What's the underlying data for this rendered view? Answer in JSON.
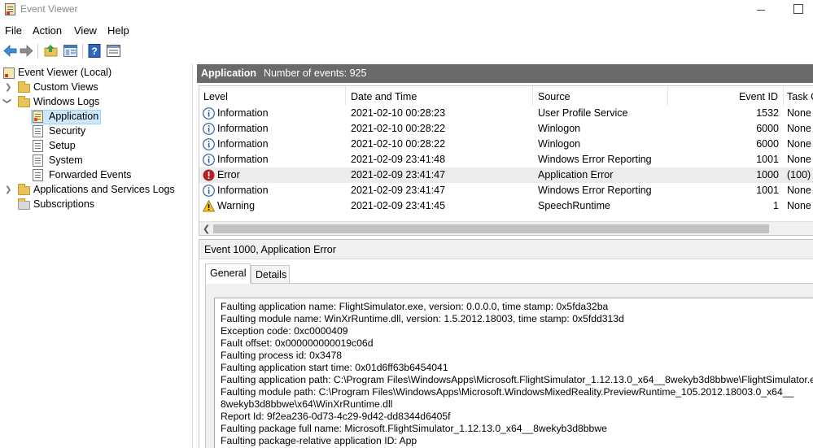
{
  "window": {
    "title": "Event Viewer"
  },
  "menu": [
    "File",
    "Action",
    "View",
    "Help"
  ],
  "toolbar": {
    "icons": [
      "back-arrow-icon",
      "forward-arrow-icon",
      "up-folder-icon",
      "show-hide-tree-icon",
      "help-icon",
      "properties-icon"
    ]
  },
  "tree": {
    "root": "Event Viewer (Local)",
    "custom_views": "Custom Views",
    "windows_logs": "Windows Logs",
    "logs": [
      "Application",
      "Security",
      "Setup",
      "System",
      "Forwarded Events"
    ],
    "apps_services": "Applications and Services Logs",
    "subscriptions": "Subscriptions"
  },
  "header": {
    "name": "Application",
    "count": "Number of events: 925"
  },
  "grid": {
    "columns": [
      "Level",
      "Date and Time",
      "Source",
      "Event ID",
      "Task C"
    ],
    "rows": [
      {
        "level": "Information",
        "date": "2021-02-10 00:28:23",
        "source": "User Profile Service",
        "event_id": "1532",
        "task": "None",
        "icon": "info-icon"
      },
      {
        "level": "Information",
        "date": "2021-02-10 00:28:22",
        "source": "Winlogon",
        "event_id": "6000",
        "task": "None",
        "icon": "info-icon"
      },
      {
        "level": "Information",
        "date": "2021-02-10 00:28:22",
        "source": "Winlogon",
        "event_id": "6000",
        "task": "None",
        "icon": "info-icon"
      },
      {
        "level": "Information",
        "date": "2021-02-09 23:41:48",
        "source": "Windows Error Reporting",
        "event_id": "1001",
        "task": "None",
        "icon": "info-icon"
      },
      {
        "level": "Error",
        "date": "2021-02-09 23:41:47",
        "source": "Application Error",
        "event_id": "1000",
        "task": "(100)",
        "icon": "error-icon"
      },
      {
        "level": "Information",
        "date": "2021-02-09 23:41:47",
        "source": "Windows Error Reporting",
        "event_id": "1001",
        "task": "None",
        "icon": "info-icon"
      },
      {
        "level": "Warning",
        "date": "2021-02-09 23:41:45",
        "source": "SpeechRuntime",
        "event_id": "1",
        "task": "None",
        "icon": "warning-icon"
      }
    ]
  },
  "detail": {
    "title": "Event 1000, Application Error",
    "tabs": [
      "General",
      "Details"
    ],
    "lines": [
      "Faulting application name: FlightSimulator.exe, version: 0.0.0.0, time stamp: 0x5fda32ba",
      "Faulting module name: WinXrRuntime.dll, version: 1.5.2012.18003, time stamp: 0x5fdd313d",
      "Exception code: 0xc0000409",
      "Fault offset: 0x000000000019c06d",
      "Faulting process id: 0x3478",
      "Faulting application start time: 0x01d6ff63b6454041",
      "Faulting application path: C:\\Program Files\\WindowsApps\\Microsoft.FlightSimulator_1.12.13.0_x64__8wekyb3d8bbwe\\FlightSimulator.exe",
      "Faulting module path: C:\\Program Files\\WindowsApps\\Microsoft.WindowsMixedReality.PreviewRuntime_105.2012.18003.0_x64__",
      "8wekyb3d8bbwe\\x64\\WinXrRuntime.dll",
      "Report Id: 9f2ea236-0d73-4c29-9d42-dd8344d6405f",
      "Faulting package full name: Microsoft.FlightSimulator_1.12.13.0_x64__8wekyb3d8bbwe",
      "Faulting package-relative application ID: App"
    ]
  }
}
